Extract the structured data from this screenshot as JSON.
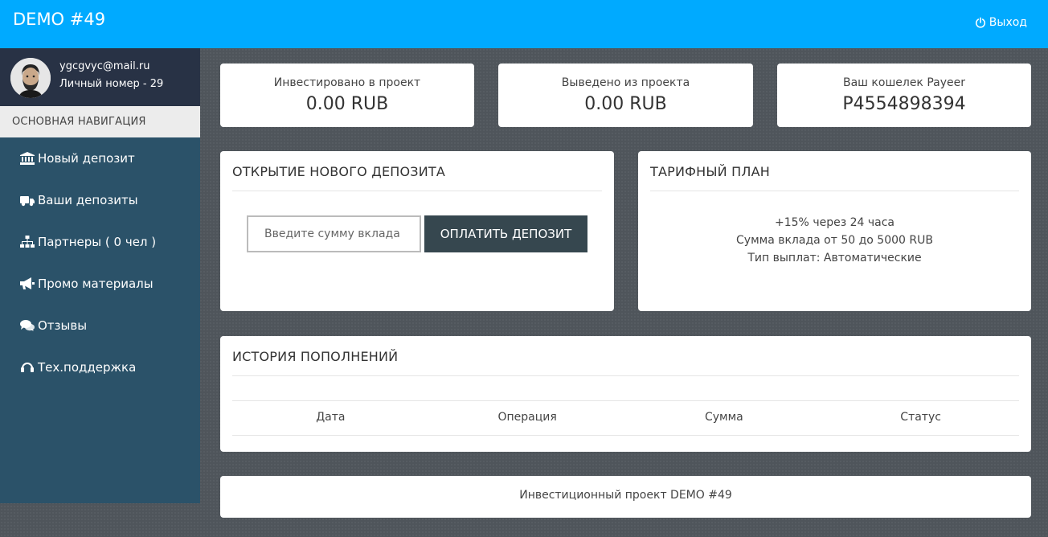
{
  "header": {
    "brand": "DEMO #49",
    "logout_label": "Выход",
    "color": "#00aaff"
  },
  "user": {
    "email": "ygcgvyc@mail.ru",
    "account_number": "Личный номер - 29"
  },
  "sidebar": {
    "header": "ОСНОВНАЯ НАВИГАЦИЯ",
    "items": [
      {
        "label": "Новый депозит",
        "icon": "bank-icon"
      },
      {
        "label": "Ваши депозиты",
        "icon": "truck-icon"
      },
      {
        "label": "Партнеры ( 0 чел )",
        "icon": "sitemap-icon"
      },
      {
        "label": "Промо материалы",
        "icon": "bullhorn-icon"
      },
      {
        "label": "Отзывы",
        "icon": "comments-icon"
      },
      {
        "label": "Тех.поддержка",
        "icon": "headset-icon"
      }
    ]
  },
  "stats": [
    {
      "label": "Инвестировано в проект",
      "value": "0.00 RUB"
    },
    {
      "label": "Выведено из проекта",
      "value": "0.00 RUB"
    },
    {
      "label": "Ваш кошелек Payeer",
      "value": "P4554898394"
    }
  ],
  "deposit": {
    "title": "ОТКРЫТИЕ НОВОГО ДЕПОЗИТА",
    "input_placeholder": "Введите сумму вклада",
    "button_label": "ОПЛАТИТЬ ДЕПОЗИТ"
  },
  "plan": {
    "title": "ТАРИФНЫЙ ПЛАН",
    "lines": [
      "+15% через 24 часа",
      "Сумма вклада от 50 до 5000 RUB",
      "Тип выплат: Автоматические"
    ]
  },
  "history": {
    "title": "ИСТОРИЯ ПОПОЛНЕНИЙ",
    "columns": [
      "Дата",
      "Операция",
      "Сумма",
      "Статус"
    ]
  },
  "footer": {
    "text": "Инвестиционный проект DEMO #49"
  }
}
